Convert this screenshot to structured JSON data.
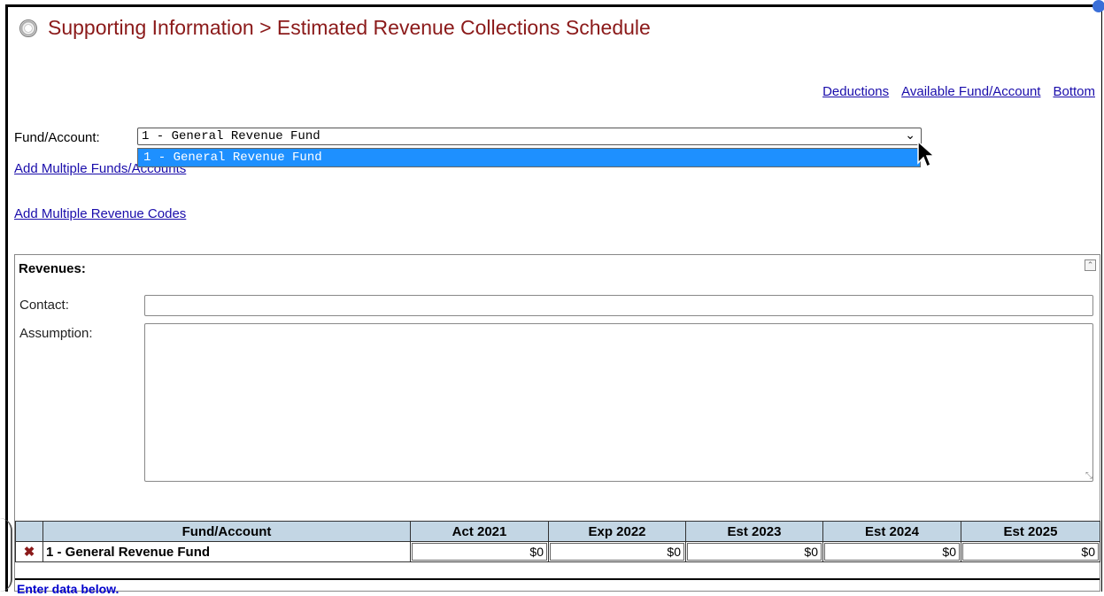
{
  "header": {
    "title": "Supporting Information > Estimated Revenue Collections Schedule"
  },
  "top_links": [
    "Deductions",
    "Available Fund/Account",
    "Bottom"
  ],
  "fund_selector": {
    "label": "Fund/Account:",
    "selected": "1 - General Revenue Fund",
    "options": [
      "1 - General Revenue Fund"
    ]
  },
  "links": {
    "add_multiple_funds": "Add Multiple Funds/Accounts",
    "add_multiple_revenue_codes": "Add Multiple Revenue Codes"
  },
  "revenues_panel": {
    "title": "Revenues:",
    "contact_label": "Contact:",
    "contact_value": "",
    "assumption_label": "Assumption:",
    "assumption_value": ""
  },
  "grid": {
    "columns": [
      "Fund/Account",
      "Act 2021",
      "Exp 2022",
      "Est 2023",
      "Est 2024",
      "Est 2025"
    ],
    "rows": [
      {
        "name": "1 - General Revenue Fund",
        "values": [
          "$0",
          "$0",
          "$0",
          "$0",
          "$0"
        ]
      }
    ],
    "note": "Enter data below."
  },
  "colors": {
    "title": "#8b1a1a",
    "link": "#1a0dab",
    "header_bg": "#c3d6e4",
    "dropdown_highlight": "#1e90ff"
  }
}
